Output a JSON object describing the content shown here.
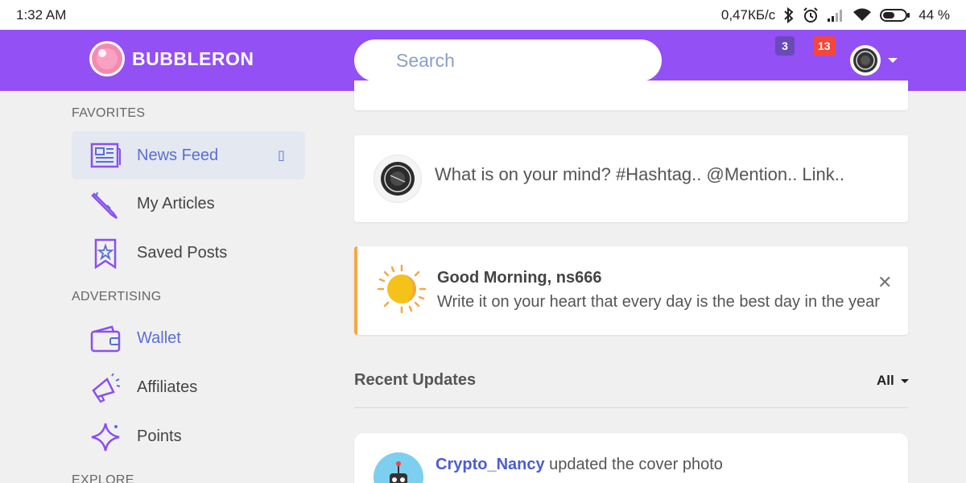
{
  "status_bar": {
    "time": "1:32 AM",
    "network_speed": "0,47КБ/с",
    "battery": "44 %"
  },
  "navbar": {
    "brand": "BUBBLERON",
    "search_placeholder": "Search",
    "messages_count": "3",
    "notifications_count": "13"
  },
  "sidebar": {
    "sections": [
      {
        "label": "FAVORITES"
      },
      {
        "label": "ADVERTISING"
      },
      {
        "label": "EXPLORE"
      }
    ],
    "items": [
      {
        "label": "News Feed",
        "icon": "newspaper-icon",
        "active": true,
        "extra": "▯"
      },
      {
        "label": "My Articles",
        "icon": "pencil-icon"
      },
      {
        "label": "Saved Posts",
        "icon": "bookmark-star-icon"
      },
      {
        "label": "Wallet",
        "icon": "wallet-icon",
        "accent": true
      },
      {
        "label": "Affiliates",
        "icon": "megaphone-icon"
      },
      {
        "label": "Points",
        "icon": "sparkle-icon"
      }
    ]
  },
  "composer": {
    "placeholder": "What is on your mind? #Hashtag.. @Mention.. Link.."
  },
  "greeting": {
    "title": "Good Morning, ns666",
    "message": "Write it on your heart that every day is the best day in the year",
    "close": "✕"
  },
  "recent": {
    "title": "Recent Updates",
    "filter": "All"
  },
  "update": {
    "user": "Crypto_Nancy",
    "action": "updated the cover photo",
    "time": ""
  },
  "colors": {
    "brand_purple": "#9350f5",
    "accent_blue": "#5a6ed4",
    "notif_red": "#f5463c",
    "msg_badge": "#6a4ab8",
    "greeting_border": "#f5a742"
  }
}
